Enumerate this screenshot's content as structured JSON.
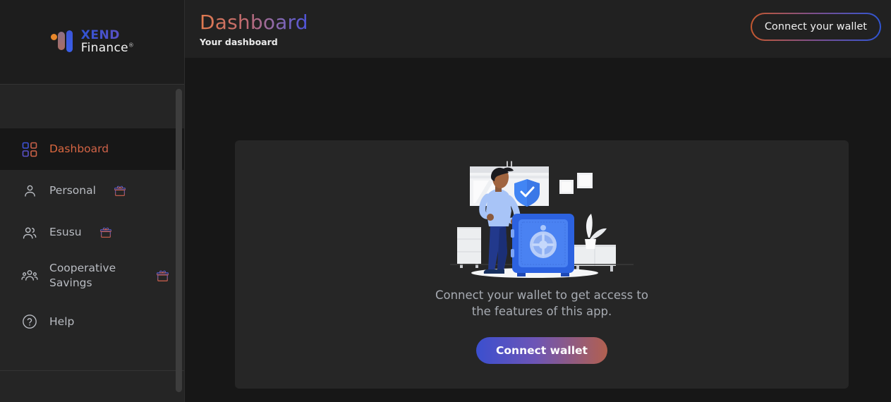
{
  "brand": {
    "name_primary": "XEND",
    "name_secondary": "Finance",
    "registered_mark": "®",
    "logo_icon": "xend-logo-mark",
    "colors": {
      "orange": "#e8872b",
      "rose": "#a86d63",
      "blue": "#3a5fe8",
      "xend_gradient_start": "#2f54d4",
      "xend_gradient_end": "#6b4fc0"
    }
  },
  "sidebar": {
    "items": [
      {
        "label": "Dashboard",
        "icon": "grid-icon",
        "active": true,
        "gift": false
      },
      {
        "label": "Personal",
        "icon": "user-icon",
        "active": false,
        "gift": true
      },
      {
        "label": "Esusu",
        "icon": "users-icon",
        "active": false,
        "gift": true
      },
      {
        "label": "Cooperative\nSavings",
        "icon": "group-icon",
        "active": false,
        "gift": true
      },
      {
        "label": "Help",
        "icon": "question-circle-icon",
        "active": false,
        "gift": false
      }
    ],
    "gift_icon_name": "gift-icon",
    "scrollbar": "sidebar-scrollbar"
  },
  "header": {
    "title": "Dashboard",
    "subtitle": "Your dashboard",
    "connect_button_label": "Connect your wallet",
    "title_gradient": [
      "#e07a4e",
      "#4a52d8"
    ]
  },
  "main": {
    "card": {
      "illustration": "wallet-safe-illustration",
      "message": "Connect your wallet to get access to the features of this app.",
      "cta_label": "Connect wallet",
      "cta_gradient": [
        "#3b4fcf",
        "#b2604f"
      ],
      "background": "#262626"
    }
  }
}
